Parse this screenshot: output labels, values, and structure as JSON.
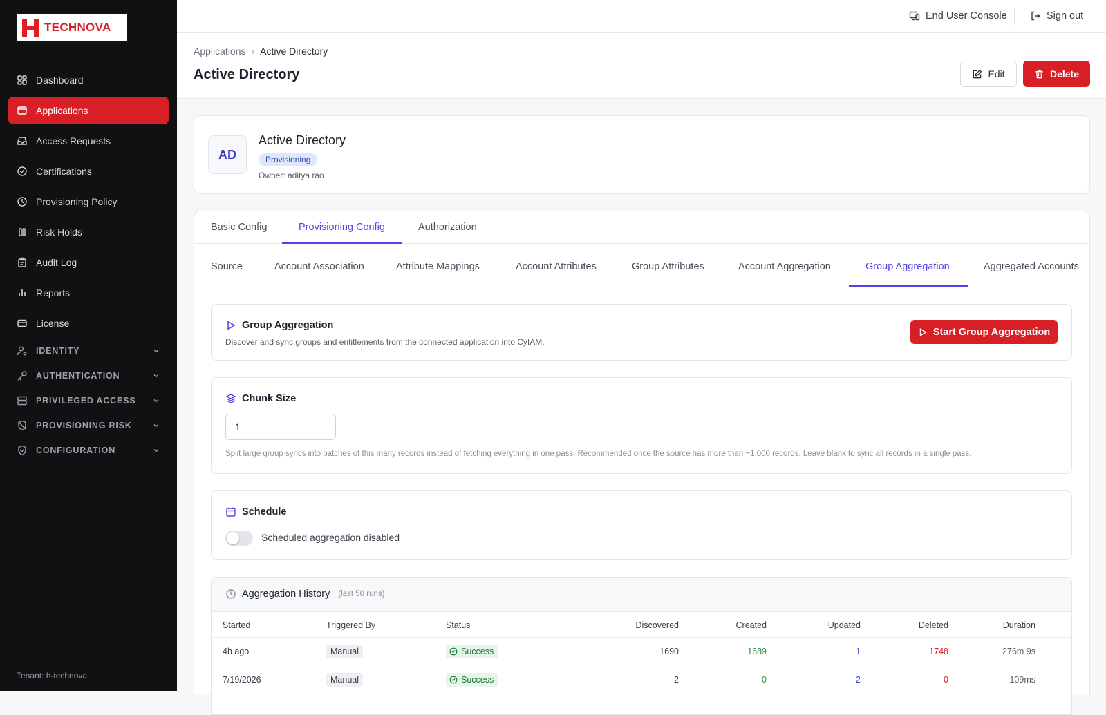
{
  "brand": {
    "name": "TECHNOVA"
  },
  "topbar": {
    "console": "End User Console",
    "signout": "Sign out"
  },
  "sidebar": {
    "items": [
      {
        "label": "Dashboard",
        "icon": "dashboard-icon"
      },
      {
        "label": "Applications",
        "icon": "applications-icon",
        "active": true
      },
      {
        "label": "Access Requests",
        "icon": "inbox-icon"
      },
      {
        "label": "Certifications",
        "icon": "check-circle-icon"
      },
      {
        "label": "Provisioning Policy",
        "icon": "policy-icon"
      },
      {
        "label": "Risk Holds",
        "icon": "pause-icon"
      },
      {
        "label": "Audit Log",
        "icon": "clipboard-icon"
      },
      {
        "label": "Reports",
        "icon": "bar-chart-icon"
      },
      {
        "label": "License",
        "icon": "card-icon"
      }
    ],
    "sections": [
      {
        "label": "IDENTITY"
      },
      {
        "label": "AUTHENTICATION"
      },
      {
        "label": "PRIVILEGED ACCESS"
      },
      {
        "label": "PROVISIONING RISK"
      },
      {
        "label": "CONFIGURATION"
      }
    ],
    "tenant": "Tenant: h-technova"
  },
  "header": {
    "breadcrumb": [
      "Applications",
      "Active Directory"
    ],
    "title": "Active Directory",
    "edit": "Edit",
    "delete": "Delete"
  },
  "app": {
    "initials": "AD",
    "name": "Active Directory",
    "badge": "Provisioning",
    "owner": "Owner: aditya rao"
  },
  "tabs": [
    "Basic Config",
    "Provisioning Config",
    "Authorization"
  ],
  "active_tab": "Provisioning Config",
  "subtabs": [
    "Source",
    "Account Association",
    "Attribute Mappings",
    "Account Attributes",
    "Group Attributes",
    "Account Aggregation",
    "Group Aggregation",
    "Aggregated Accounts"
  ],
  "active_subtab": "Group Aggregation",
  "group_aggregation": {
    "title": "Group Aggregation",
    "desc": "Discover and sync groups and entitlements from the connected application into CyIAM.",
    "button": "Start Group Aggregation"
  },
  "chunk": {
    "title": "Chunk Size",
    "value": "1",
    "hint": "Split large group syncs into batches of this many records instead of fetching everything in one pass. Recommended once the source has more than ~1,000 records. Leave blank to sync all records in a single pass."
  },
  "schedule": {
    "title": "Schedule",
    "toggle_label": "Scheduled aggregation disabled",
    "enabled": false
  },
  "history": {
    "title": "Aggregation History",
    "subtitle": "(last 50 runs)",
    "columns": [
      "Started",
      "Triggered By",
      "Status",
      "Discovered",
      "Created",
      "Updated",
      "Deleted",
      "Duration"
    ],
    "rows": [
      {
        "started": "4h ago",
        "by": "Manual",
        "status": "Success",
        "discovered": "1690",
        "created": "1689",
        "updated": "1",
        "deleted": "1748",
        "duration": "276m 9s"
      },
      {
        "started": "7/19/2026",
        "by": "Manual",
        "status": "Success",
        "discovered": "2",
        "created": "0",
        "updated": "2",
        "deleted": "0",
        "duration": "109ms"
      }
    ]
  },
  "colors": {
    "accent": "#d81f26",
    "primary": "#4f46e5",
    "sidebar_bg": "#111113"
  }
}
